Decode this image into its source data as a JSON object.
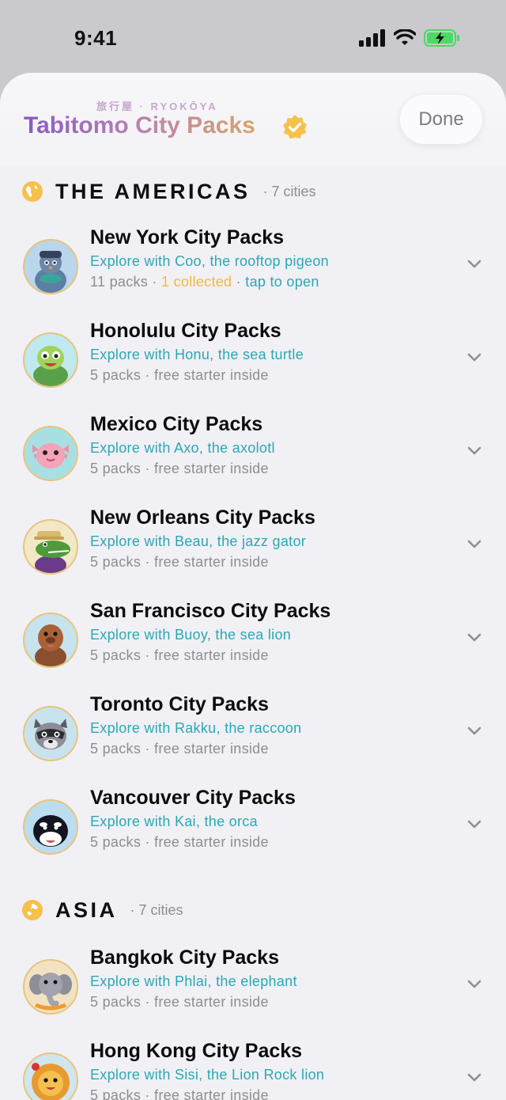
{
  "status": {
    "time": "9:41"
  },
  "header": {
    "subtitle": "旅行屋 · RYOKŌYA",
    "title": "Tabitomo City Packs",
    "done_label": "Done"
  },
  "sections": [
    {
      "title": "THE AMERICAS",
      "count": "· 7 cities",
      "cities": [
        {
          "title": "New York City Packs",
          "guide": "Explore with Coo, the rooftop pigeon",
          "meta": "11 packs · ",
          "meta_collected": "1 collected",
          "meta_sep": " · ",
          "meta_tap": "tap to open"
        },
        {
          "title": "Honolulu City Packs",
          "guide": "Explore with Honu, the sea turtle",
          "meta": "5 packs · free starter inside"
        },
        {
          "title": "Mexico City Packs",
          "guide": "Explore with Axo, the axolotl",
          "meta": "5 packs · free starter inside"
        },
        {
          "title": "New Orleans City Packs",
          "guide": "Explore with Beau, the jazz gator",
          "meta": "5 packs · free starter inside"
        },
        {
          "title": "San Francisco City Packs",
          "guide": "Explore with Buoy, the sea lion",
          "meta": "5 packs · free starter inside"
        },
        {
          "title": "Toronto City Packs",
          "guide": "Explore with Rakku, the raccoon",
          "meta": "5 packs · free starter inside"
        },
        {
          "title": "Vancouver City Packs",
          "guide": "Explore with Kai, the orca",
          "meta": "5 packs · free starter inside"
        }
      ]
    },
    {
      "title": "ASIA",
      "count": "· 7 cities",
      "cities": [
        {
          "title": "Bangkok City Packs",
          "guide": "Explore with Phlai, the elephant",
          "meta": "5 packs · free starter inside"
        },
        {
          "title": "Hong Kong City Packs",
          "guide": "Explore with Sisi, the Lion Rock lion",
          "meta": "5 packs · free starter inside"
        }
      ]
    }
  ],
  "colors": {
    "accent_teal": "#2aa8b5",
    "accent_gold": "#f2b93b",
    "badge": "#f6c14a"
  }
}
